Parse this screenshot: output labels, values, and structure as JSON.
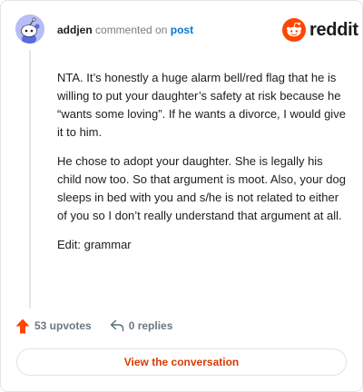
{
  "header": {
    "username": "addjen",
    "action": "commented on",
    "target": "post"
  },
  "brand": {
    "name": "reddit",
    "logo_icon": "reddit-alien-icon",
    "color": "#ff4500"
  },
  "avatar": {
    "icon": "snoo-avatar",
    "color": "#b7bdf6"
  },
  "comment": {
    "paragraphs": [
      "NTA. It’s honestly a huge alarm bell/red flag that he is willing to put your daughter’s safety at risk because he “wants some loving”. If he wants a divorce, I would give it to him.",
      "He chose to adopt your daughter. She is legally his child now too. So that argument is moot. Also, your dog sleeps in bed with you and s/he is not related to either of you so I don’t really understand that argument at all.",
      "Edit: grammar"
    ]
  },
  "actions": {
    "upvotes": "53 upvotes",
    "replies": "0 replies",
    "upvote_icon": "upvote-arrow-icon",
    "reply_icon": "reply-arrow-icon",
    "upvote_color": "#ff4500"
  },
  "cta": {
    "label": "View the conversation",
    "color": "#d93a00"
  }
}
